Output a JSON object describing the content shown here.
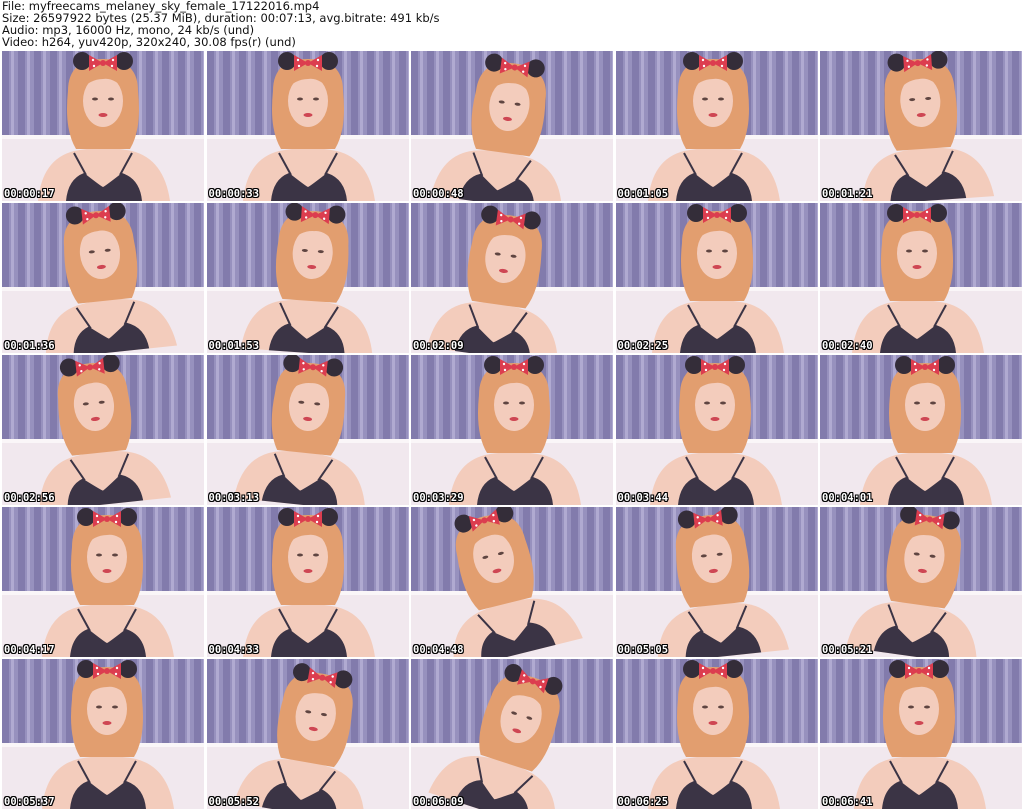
{
  "header": {
    "file_line": "File: myfreecams_melaney_sky_female_17122016.mp4",
    "size_line": "Size: 26597922 bytes (25.37 MiB), duration: 00:07:13, avg.bitrate: 491 kb/s",
    "audio_line": "Audio: mp3, 16000 Hz, mono, 24 kb/s (und)",
    "video_line": "Video: h264, yuv420p, 320x240, 30.08 fps(r) (und)"
  },
  "thumbnails": [
    {
      "timestamp": "00:00:17"
    },
    {
      "timestamp": "00:00:33"
    },
    {
      "timestamp": "00:00:48"
    },
    {
      "timestamp": "00:01:05"
    },
    {
      "timestamp": "00:01:21"
    },
    {
      "timestamp": "00:01:36"
    },
    {
      "timestamp": "00:01:53"
    },
    {
      "timestamp": "00:02:09"
    },
    {
      "timestamp": "00:02:25"
    },
    {
      "timestamp": "00:02:40"
    },
    {
      "timestamp": "00:02:56"
    },
    {
      "timestamp": "00:03:13"
    },
    {
      "timestamp": "00:03:29"
    },
    {
      "timestamp": "00:03:44"
    },
    {
      "timestamp": "00:04:01"
    },
    {
      "timestamp": "00:04:17"
    },
    {
      "timestamp": "00:04:33"
    },
    {
      "timestamp": "00:04:48"
    },
    {
      "timestamp": "00:05:05"
    },
    {
      "timestamp": "00:05:21"
    },
    {
      "timestamp": "00:05:37"
    },
    {
      "timestamp": "00:05:52"
    },
    {
      "timestamp": "00:06:09"
    },
    {
      "timestamp": "00:06:25"
    },
    {
      "timestamp": "00:06:41"
    }
  ],
  "colors": {
    "curtain": "#8a86b8",
    "curtain_dark": "#5e5a92",
    "curtain_light": "#c9c5e6",
    "hair": "#e0955e",
    "skin": "#f3c9b6",
    "top": "#221c2e",
    "couch": "#f1e9ee",
    "bow": "#d9263a",
    "ears": "#1a1420"
  }
}
